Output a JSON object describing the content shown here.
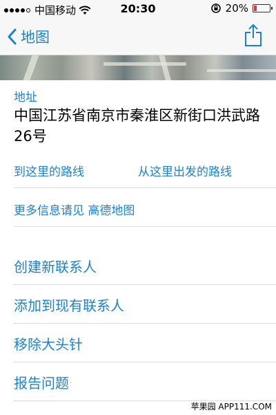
{
  "status": {
    "carrier": "中国移动",
    "time": "20:30",
    "battery": "20%",
    "battery_level": 0.2,
    "signal_bars": 4
  },
  "nav": {
    "back_label": "地图"
  },
  "address": {
    "label": "地址",
    "text": "中国江苏省南京市秦淮区新街口洪武路26号"
  },
  "directions": {
    "to_here": "到这里的路线",
    "from_here": "从这里出发的路线"
  },
  "more_info": "更多信息请见 高德地图",
  "actions": {
    "create_contact": "创建新联系人",
    "add_existing": "添加到现有联系人",
    "remove_pin": "移除大头针",
    "report_problem": "报告问题"
  },
  "watermark": "苹果园 APP111.COM",
  "colors": {
    "accent": "#1a82d6",
    "battery_low": "#e33333"
  }
}
